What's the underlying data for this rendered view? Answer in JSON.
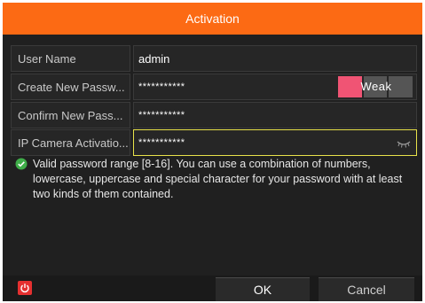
{
  "dialog": {
    "title": "Activation"
  },
  "form": {
    "user_name": {
      "label": "User Name",
      "value": "admin"
    },
    "new_password": {
      "label": "Create New Passw...",
      "value": "***********"
    },
    "strength": {
      "label": "Weak",
      "level": 0.33,
      "color": "#f05474"
    },
    "confirm_password": {
      "label": "Confirm New Pass...",
      "value": "***********"
    },
    "ip_camera_password": {
      "label": "IP Camera Activatio...",
      "value": "***********",
      "eye_icon": "eye-closed-icon"
    }
  },
  "hint": {
    "icon": "check-circle-icon",
    "text": "Valid password range [8-16]. You can use a combination of numbers, lowercase, uppercase and special character for your password with at least two kinds of them contained."
  },
  "footer": {
    "power_icon": "power-icon",
    "ok_label": "OK",
    "cancel_label": "Cancel"
  },
  "colors": {
    "accent": "#fc6a14",
    "focus": "#e8e24a",
    "power": "#e53030"
  }
}
